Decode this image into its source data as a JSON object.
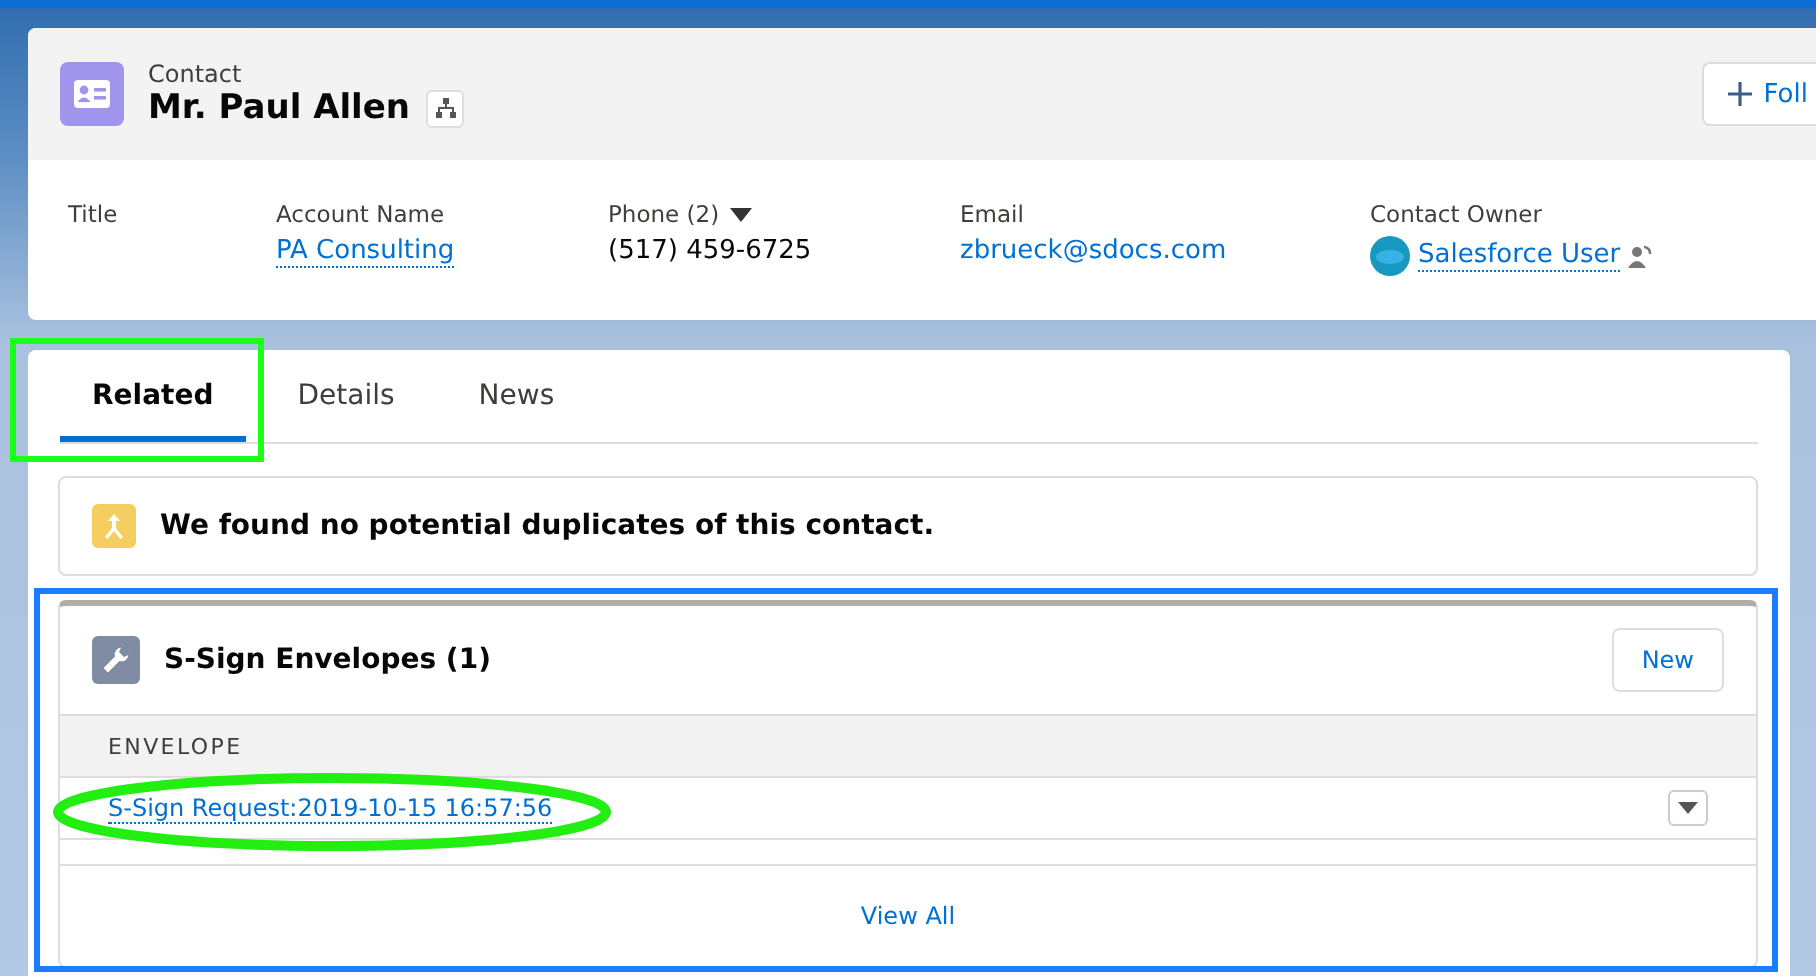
{
  "header": {
    "object_type": "Contact",
    "name": "Mr. Paul Allen",
    "follow_button": "Foll"
  },
  "fields": [
    {
      "kind": "empty",
      "label": "Title"
    },
    {
      "kind": "link",
      "label": "Account Name",
      "value": "PA Consulting"
    },
    {
      "kind": "dropdown",
      "label": "Phone (2)",
      "value": "(517) 459-6725"
    },
    {
      "kind": "plain_link",
      "label": "Email",
      "value": "zbrueck@sdocs.com"
    },
    {
      "kind": "owner",
      "label": "Contact Owner",
      "value": "Salesforce User"
    }
  ],
  "tabs": [
    {
      "label": "Related",
      "selected": true
    },
    {
      "label": "Details",
      "selected": false
    },
    {
      "label": "News",
      "selected": false
    }
  ],
  "duplicates_notice": "We found no potential duplicates of this contact.",
  "related_list": {
    "title": "S-Sign Envelopes (1)",
    "new_button": "New",
    "columns": [
      "ENVELOPE"
    ],
    "rows": [
      {
        "envelope": "S-Sign Request:2019-10-15 16:57:56"
      }
    ],
    "view_all": "View All"
  }
}
